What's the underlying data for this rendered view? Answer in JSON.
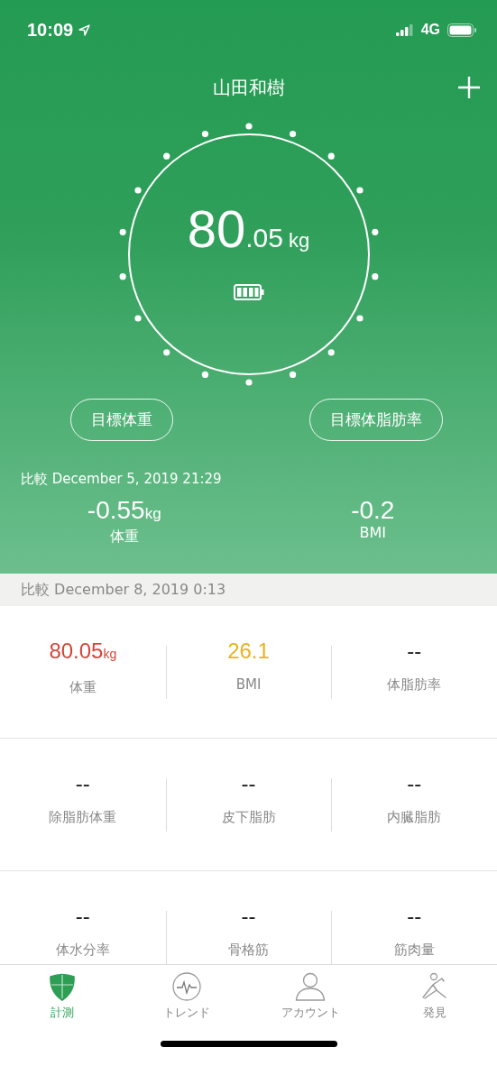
{
  "status_bar": {
    "time": "10:09",
    "network": "4G"
  },
  "header": {
    "title": "山田和樹"
  },
  "reading": {
    "integer": "80",
    "decimal": ".05",
    "unit": "kg"
  },
  "goal_buttons": [
    "目標体重",
    "目標体脂肪率"
  ],
  "comparison": {
    "label": "比較 December 5, 2019 21:29",
    "items": [
      {
        "value": "-0.55",
        "unit": "kg",
        "label": "体重"
      },
      {
        "value": "-0.2",
        "label": "BMI"
      }
    ]
  },
  "section_header": "比較 December 8, 2019 0:13",
  "metrics": [
    {
      "value": "80.05",
      "unit": "kg",
      "label": "体重",
      "color": "#d2473a"
    },
    {
      "value": "26.1",
      "label": "BMI",
      "color": "#e6b422"
    },
    {
      "value": "--",
      "label": "体脂肪率",
      "color": "#222222"
    },
    {
      "value": "--",
      "label": "除脂肪体重",
      "color": "#222222"
    },
    {
      "value": "--",
      "label": "皮下脂肪",
      "color": "#222222"
    },
    {
      "value": "--",
      "label": "内臓脂肪",
      "color": "#222222"
    },
    {
      "value": "--",
      "label": "体水分率",
      "color": "#222222"
    },
    {
      "value": "--",
      "label": "骨格筋",
      "color": "#222222"
    },
    {
      "value": "--",
      "label": "筋肉量",
      "color": "#222222"
    }
  ],
  "tabs": [
    {
      "kind": "measure",
      "label": "計測",
      "selected": true
    },
    {
      "kind": "trend",
      "label": "トレンド",
      "selected": false
    },
    {
      "kind": "account",
      "label": "アカウント",
      "selected": false
    },
    {
      "kind": "discover",
      "label": "発見",
      "selected": false
    }
  ]
}
